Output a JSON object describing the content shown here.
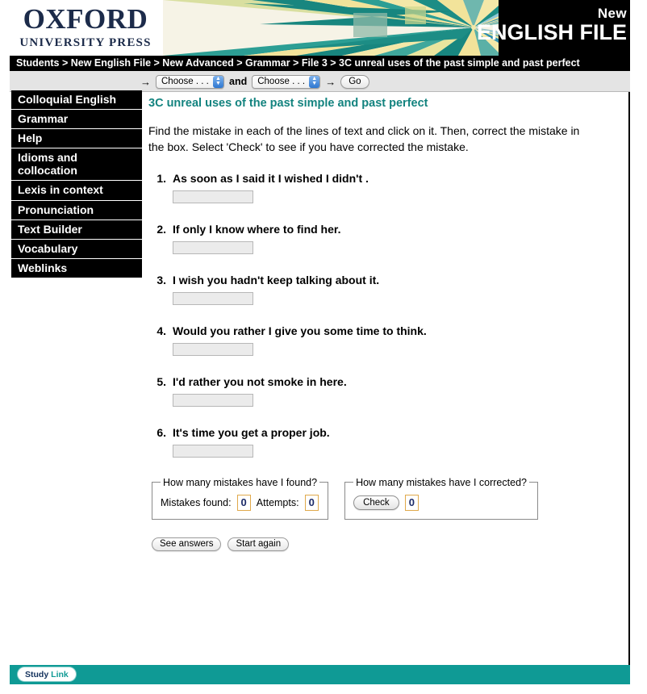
{
  "masthead": {
    "publisher_main": "OXFORD",
    "publisher_sub": "UNIVERSITY PRESS",
    "series_prefix": "New",
    "series_title": "ENGLISH FILE"
  },
  "breadcrumb": {
    "text": "Students > New English File > New Advanced > Grammar > File 3 > 3C unreal uses of the past simple and past perfect"
  },
  "toolbar": {
    "arrow_left": "→",
    "select_one_value": "Choose . . .",
    "conjunction": "and",
    "select_two_value": "Choose . . .",
    "arrow_right": "→",
    "go_label": "Go"
  },
  "sidebar": {
    "items": [
      {
        "label": "Colloquial English"
      },
      {
        "label": "Grammar"
      },
      {
        "label": "Help"
      },
      {
        "label": "Idioms and collocation"
      },
      {
        "label": "Lexis in context"
      },
      {
        "label": "Pronunciation"
      },
      {
        "label": "Text Builder"
      },
      {
        "label": "Vocabulary"
      },
      {
        "label": "Weblinks"
      }
    ]
  },
  "main": {
    "title": "3C unreal uses of the past simple and past perfect",
    "instructions": "Find the mistake in each of the lines of text and click on it. Then, correct the mistake in the box. Select 'Check' to see if you have corrected the mistake.",
    "questions": [
      {
        "number": "1.",
        "text": "As soon as I said it I wished I didn't .",
        "answer": ""
      },
      {
        "number": "2.",
        "text": "If only I know where to find her.",
        "answer": ""
      },
      {
        "number": "3.",
        "text": "I wish you hadn't keep talking about it.",
        "answer": ""
      },
      {
        "number": "4.",
        "text": "Would you rather I give you some time to think.",
        "answer": ""
      },
      {
        "number": "5.",
        "text": "I'd rather you not smoke in here.",
        "answer": ""
      },
      {
        "number": "6.",
        "text": "It's time you get a proper job.",
        "answer": ""
      }
    ],
    "score_found": {
      "legend": "How many mistakes have I found?",
      "mistakes_label": "Mistakes found:",
      "mistakes_value": "0",
      "attempts_label": "Attempts:",
      "attempts_value": "0"
    },
    "score_corrected": {
      "legend": "How many mistakes have I corrected?",
      "check_label": "Check",
      "corrected_value": "0"
    },
    "actions": {
      "see_answers": "See answers",
      "start_again": "Start again"
    }
  },
  "footer": {
    "studylink_first": "Study",
    "studylink_second": "Link"
  },
  "colors": {
    "teal": "#0f9a95",
    "heading_teal": "#13837f",
    "navy": "#1c2b4a",
    "score_border": "#e0a94b",
    "score_value": "#1c2b68"
  }
}
